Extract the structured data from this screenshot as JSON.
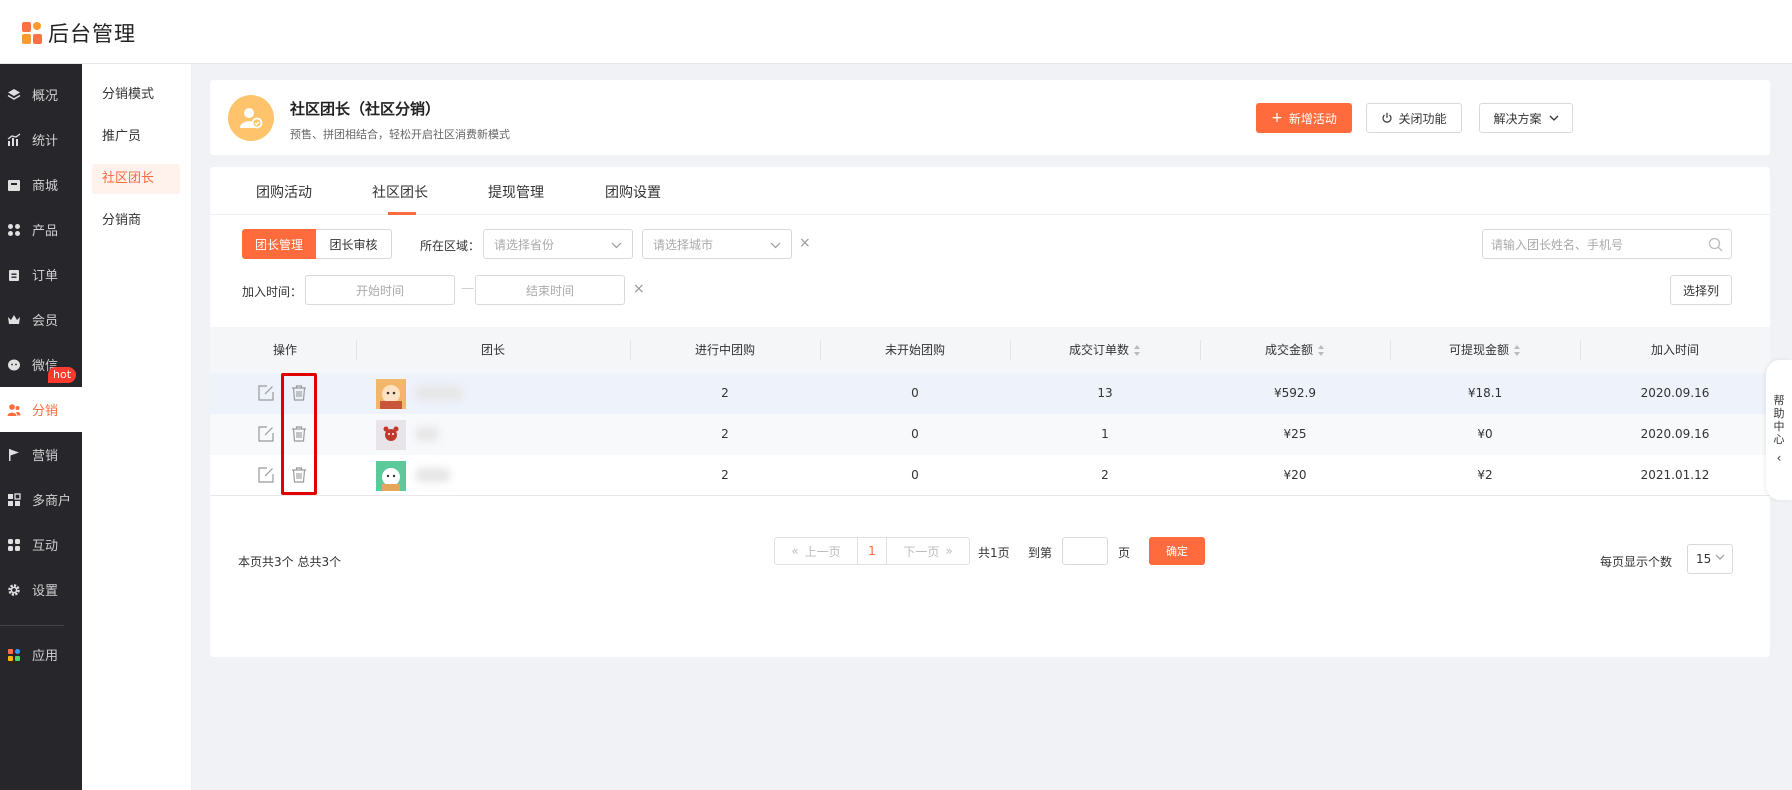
{
  "app": {
    "logo_text": "后台管理"
  },
  "sidebar": {
    "items": [
      {
        "label": "概况",
        "icon": "layers-icon"
      },
      {
        "label": "统计",
        "icon": "chart-icon"
      },
      {
        "label": "商城",
        "icon": "store-icon"
      },
      {
        "label": "产品",
        "icon": "grid-icon"
      },
      {
        "label": "订单",
        "icon": "clipboard-icon"
      },
      {
        "label": "会员",
        "icon": "crown-icon"
      },
      {
        "label": "微信",
        "icon": "wechat-icon"
      },
      {
        "label": "分销",
        "icon": "users-icon",
        "active": true
      },
      {
        "label": "营销",
        "icon": "flag-icon",
        "badge": "hot"
      },
      {
        "label": "多商户",
        "icon": "merchant-icon"
      },
      {
        "label": "互动",
        "icon": "grid-icon"
      },
      {
        "label": "设置",
        "icon": "gear-icon"
      },
      {
        "label": "应用",
        "icon": "apps-icon"
      }
    ]
  },
  "submenu": {
    "items": [
      {
        "label": "分销模式"
      },
      {
        "label": "推广员"
      },
      {
        "label": "社区团长",
        "active": true
      },
      {
        "label": "分销商"
      }
    ]
  },
  "header": {
    "title": "社区团长（社区分销）",
    "subtitle": "预售、拼团相结合，轻松开启社区消费新模式",
    "add_label": "新增活动",
    "close_label": "关闭功能",
    "solution_label": "解决方案"
  },
  "tabs": [
    {
      "label": "团购活动"
    },
    {
      "label": "社区团长",
      "active": true
    },
    {
      "label": "提现管理"
    },
    {
      "label": "团购设置"
    }
  ],
  "filters": {
    "seg_manage": "团长管理",
    "seg_review": "团长审核",
    "region_label": "所在区域：",
    "province_placeholder": "请选择省份",
    "city_placeholder": "请选择城市",
    "search_placeholder": "请输入团长姓名、手机号",
    "join_label": "加入时间：",
    "start_placeholder": "开始时间",
    "end_placeholder": "结束时间",
    "columns_button": "选择列"
  },
  "table": {
    "headers": [
      "操作",
      "团长",
      "进行中团购",
      "未开始团购",
      "成交订单数",
      "成交金额",
      "可提现金额",
      "加入时间"
    ],
    "rows": [
      {
        "ongoing": "2",
        "pending": "0",
        "orders": "13",
        "amount": "¥592.9",
        "withdrawable": "¥18.1",
        "joined": "2020.09.16"
      },
      {
        "ongoing": "2",
        "pending": "0",
        "orders": "1",
        "amount": "¥25",
        "withdrawable": "¥0",
        "joined": "2020.09.16"
      },
      {
        "ongoing": "2",
        "pending": "0",
        "orders": "2",
        "amount": "¥20",
        "withdrawable": "¥2",
        "joined": "2021.01.12"
      }
    ]
  },
  "pagination": {
    "count_text": "本页共3个  总共3个",
    "prev": "上一页",
    "current": "1",
    "next": "下一页",
    "total_pages": "共1页",
    "goto_label": "到第",
    "page_unit": "页",
    "confirm": "确定",
    "per_page_label": "每页显示个数",
    "per_page_value": "15"
  },
  "help": {
    "label": "帮助中心"
  },
  "colors": {
    "accent": "#ff6b3d",
    "sidebar_bg": "#27272b",
    "highlight": "#e00000"
  }
}
